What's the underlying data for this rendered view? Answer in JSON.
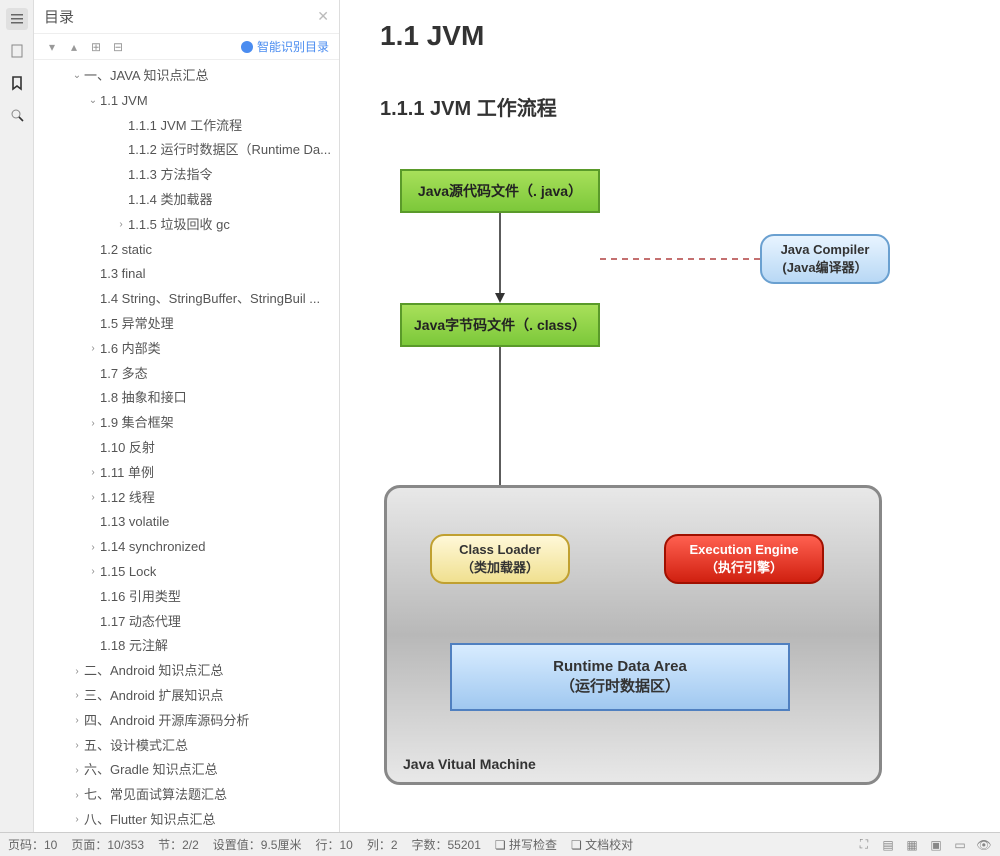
{
  "sidebar": {
    "title": "目录",
    "smart_toc": "智能识别目录",
    "items": [
      {
        "label": "一、JAVA 知识点汇总",
        "level": 0,
        "caret": "v"
      },
      {
        "label": "1.1 JVM",
        "level": 1,
        "caret": "v"
      },
      {
        "label": "1.1.1 JVM  工作流程",
        "level": 2,
        "caret": ""
      },
      {
        "label": "1.1.2 运行时数据区（Runtime Da...",
        "level": 2,
        "caret": ""
      },
      {
        "label": "1.1.3 方法指令",
        "level": 2,
        "caret": ""
      },
      {
        "label": "1.1.4 类加载器",
        "level": 2,
        "caret": ""
      },
      {
        "label": "1.1.5 垃圾回收  gc",
        "level": 2,
        "caret": ">"
      },
      {
        "label": "1.2 static",
        "level": 1,
        "caret": ""
      },
      {
        "label": "1.3 final",
        "level": 1,
        "caret": ""
      },
      {
        "label": "1.4 String、StringBuffer、StringBuil ...",
        "level": 1,
        "caret": ""
      },
      {
        "label": "1.5  异常处理",
        "level": 1,
        "caret": ""
      },
      {
        "label": "1.6  内部类",
        "level": 1,
        "caret": ">"
      },
      {
        "label": "1.7  多态",
        "level": 1,
        "caret": ""
      },
      {
        "label": "1.8  抽象和接口",
        "level": 1,
        "caret": ""
      },
      {
        "label": "1.9  集合框架",
        "level": 1,
        "caret": ">"
      },
      {
        "label": "1.10  反射",
        "level": 1,
        "caret": ""
      },
      {
        "label": "1.11  单例",
        "level": 1,
        "caret": ">"
      },
      {
        "label": "1.12  线程",
        "level": 1,
        "caret": ">"
      },
      {
        "label": "1.13  volatile",
        "level": 1,
        "caret": ""
      },
      {
        "label": "1.14  synchronized",
        "level": 1,
        "caret": ">"
      },
      {
        "label": "1.15  Lock",
        "level": 1,
        "caret": ">"
      },
      {
        "label": "1.16  引用类型",
        "level": 1,
        "caret": ""
      },
      {
        "label": "1.17  动态代理",
        "level": 1,
        "caret": ""
      },
      {
        "label": "1.18  元注解",
        "level": 1,
        "caret": ""
      },
      {
        "label": "二、Android 知识点汇总",
        "level": 0,
        "caret": ">"
      },
      {
        "label": "三、Android 扩展知识点",
        "level": 0,
        "caret": ">"
      },
      {
        "label": "四、Android 开源库源码分析",
        "level": 0,
        "caret": ">"
      },
      {
        "label": "五、设计模式汇总",
        "level": 0,
        "caret": ">"
      },
      {
        "label": "六、Gradle 知识点汇总",
        "level": 0,
        "caret": ">"
      },
      {
        "label": "七、常见面试算法题汇总",
        "level": 0,
        "caret": ">"
      },
      {
        "label": "八、Flutter 知识点汇总",
        "level": 0,
        "caret": ">"
      }
    ]
  },
  "content": {
    "h1": "1.1 JVM",
    "h2": "1.1.1 JVM  工作流程",
    "diagram": {
      "java_src": "Java源代码文件（. java）",
      "javac_line1": "Java Compiler",
      "javac_line2": "(Java编译器）",
      "java_class": "Java字节码文件（. class）",
      "loader_line1": "Class Loader",
      "loader_line2": "（类加载器）",
      "engine_line1": "Execution Engine",
      "engine_line2": "（执行引擎）",
      "runtime_line1": "Runtime  Data  Area",
      "runtime_line2": "（运行时数据区）",
      "jvm_label": "Java Vitual Machine"
    }
  },
  "status": {
    "page_num": "页码：10",
    "page": "页面：10/353",
    "section": "节：2/2",
    "setting": "设置值：9.5厘米",
    "row": "行：10",
    "col": "列：2",
    "chars": "字数：55201",
    "spellcheck": "拼写检查",
    "doccheck": "文档校对"
  }
}
